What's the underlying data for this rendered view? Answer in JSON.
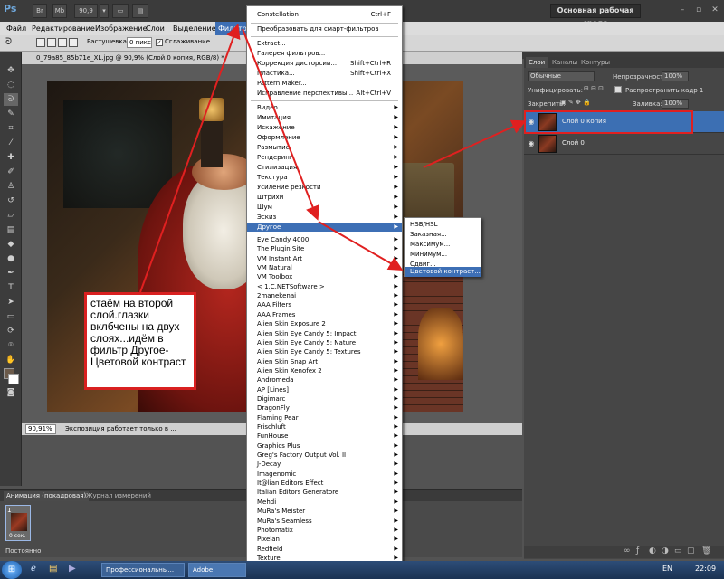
{
  "titlebar": {
    "buttons": [
      "Br",
      "Mb",
      "90,9",
      "▾",
      "▭",
      "▤"
    ],
    "workspace": "Основная рабочая среда",
    "window_controls": [
      "–",
      "▫",
      "✕"
    ]
  },
  "menubar": {
    "items": [
      "Файл",
      "Редактирование",
      "Изображение",
      "Слои",
      "Выделение",
      "Фильтр"
    ]
  },
  "options": {
    "feather_label": "Растушевка:",
    "feather_value": "0 пикс",
    "antialias_label": "Сглаживание"
  },
  "document": {
    "tab_title": "0_79a85_85b71e_XL.jpg @ 90,9% (Слой 0 копия, RGB/8) *",
    "zoom": "90,91%",
    "status": "Экспозиция работает только в ..."
  },
  "filter_menu": {
    "top_items": [
      {
        "label": "Constellation",
        "shortcut": "Ctrl+F"
      }
    ],
    "smart": {
      "label": "Преобразовать для смарт-фильтров"
    },
    "group1": [
      {
        "label": "Extract...",
        "shortcut": ""
      },
      {
        "label": "Галерея фильтров...",
        "shortcut": ""
      },
      {
        "label": "Коррекция дисторсии...",
        "shortcut": "Shift+Ctrl+R"
      },
      {
        "label": "Пластика...",
        "shortcut": "Shift+Ctrl+X"
      },
      {
        "label": "Pattern Maker...",
        "shortcut": ""
      },
      {
        "label": "Исправление перспективы...",
        "shortcut": "Alt+Ctrl+V"
      }
    ],
    "group2": [
      "Видео",
      "Имитация",
      "Искажение",
      "Оформление",
      "Размытие",
      "Рендеринг",
      "Стилизация",
      "Текстура",
      "Усиление резкости",
      "Штрихи",
      "Шум",
      "Эскиз",
      "Другое"
    ],
    "group3": [
      "Eye Candy 4000",
      "The Plugin Site",
      "VM Instant Art",
      "VM Natural",
      "VM Toolbox",
      "< 1.C.NETSoftware >",
      "2manekenai",
      "AAA Filters",
      "AAA Frames",
      "Alien Skin Exposure 2",
      "Alien Skin Eye Candy 5: Impact",
      "Alien Skin Eye Candy 5: Nature",
      "Alien Skin Eye Candy 5: Textures",
      "Alien Skin Snap Art",
      "Alien Skin Xenofex 2",
      "Andromeda",
      "AP [Lines]",
      "Digimarc",
      "DragonFly",
      "Flaming Pear",
      "Frischluft",
      "FunHouse",
      "Graphics Plus",
      "Greg's Factory Output Vol. II",
      "J-Decay",
      "Imagenomic",
      "It@lian Editors Effect",
      "Italian Editors Generatore",
      "Mehdi",
      "MuRa's Meister",
      "MuRa's Seamless",
      "Photomatix",
      "Pixelan",
      "Redfield",
      "Texture"
    ],
    "more_arrow": "▾"
  },
  "submenu": {
    "items": [
      "HSB/HSL",
      "Заказная...",
      "Максимум...",
      "Минимум...",
      "Сдвиг...",
      "Цветовой контраст..."
    ]
  },
  "annotation": {
    "text": "стаём на второй слой.глазки вклбчены на двух слоях...идём в фильтр Другое-Цветовой контраст"
  },
  "layers": {
    "tabs": [
      "Слои",
      "Каналы",
      "Контуры"
    ],
    "blend_mode": "Обычные",
    "opacity_label": "Непрозрачность:",
    "opacity_value": "100%",
    "unify_label": "Унифицировать:",
    "propagate_label": "Распространить кадр 1",
    "lock_label": "Закрепить:",
    "fill_label": "Заливка:",
    "fill_value": "100%",
    "items": [
      {
        "name": "Слой 0 копия"
      },
      {
        "name": "Слой 0"
      }
    ]
  },
  "animation": {
    "tabs": [
      "Анимация (покадровая)",
      "Журнал измерений"
    ],
    "frame_number": "1",
    "frame_delay": "0 сек.",
    "loop": "Постоянно"
  },
  "taskbar": {
    "tasks": [
      "Профессиональны...",
      "Adobe Photosh..."
    ],
    "lang": "EN",
    "time": "22:09"
  }
}
